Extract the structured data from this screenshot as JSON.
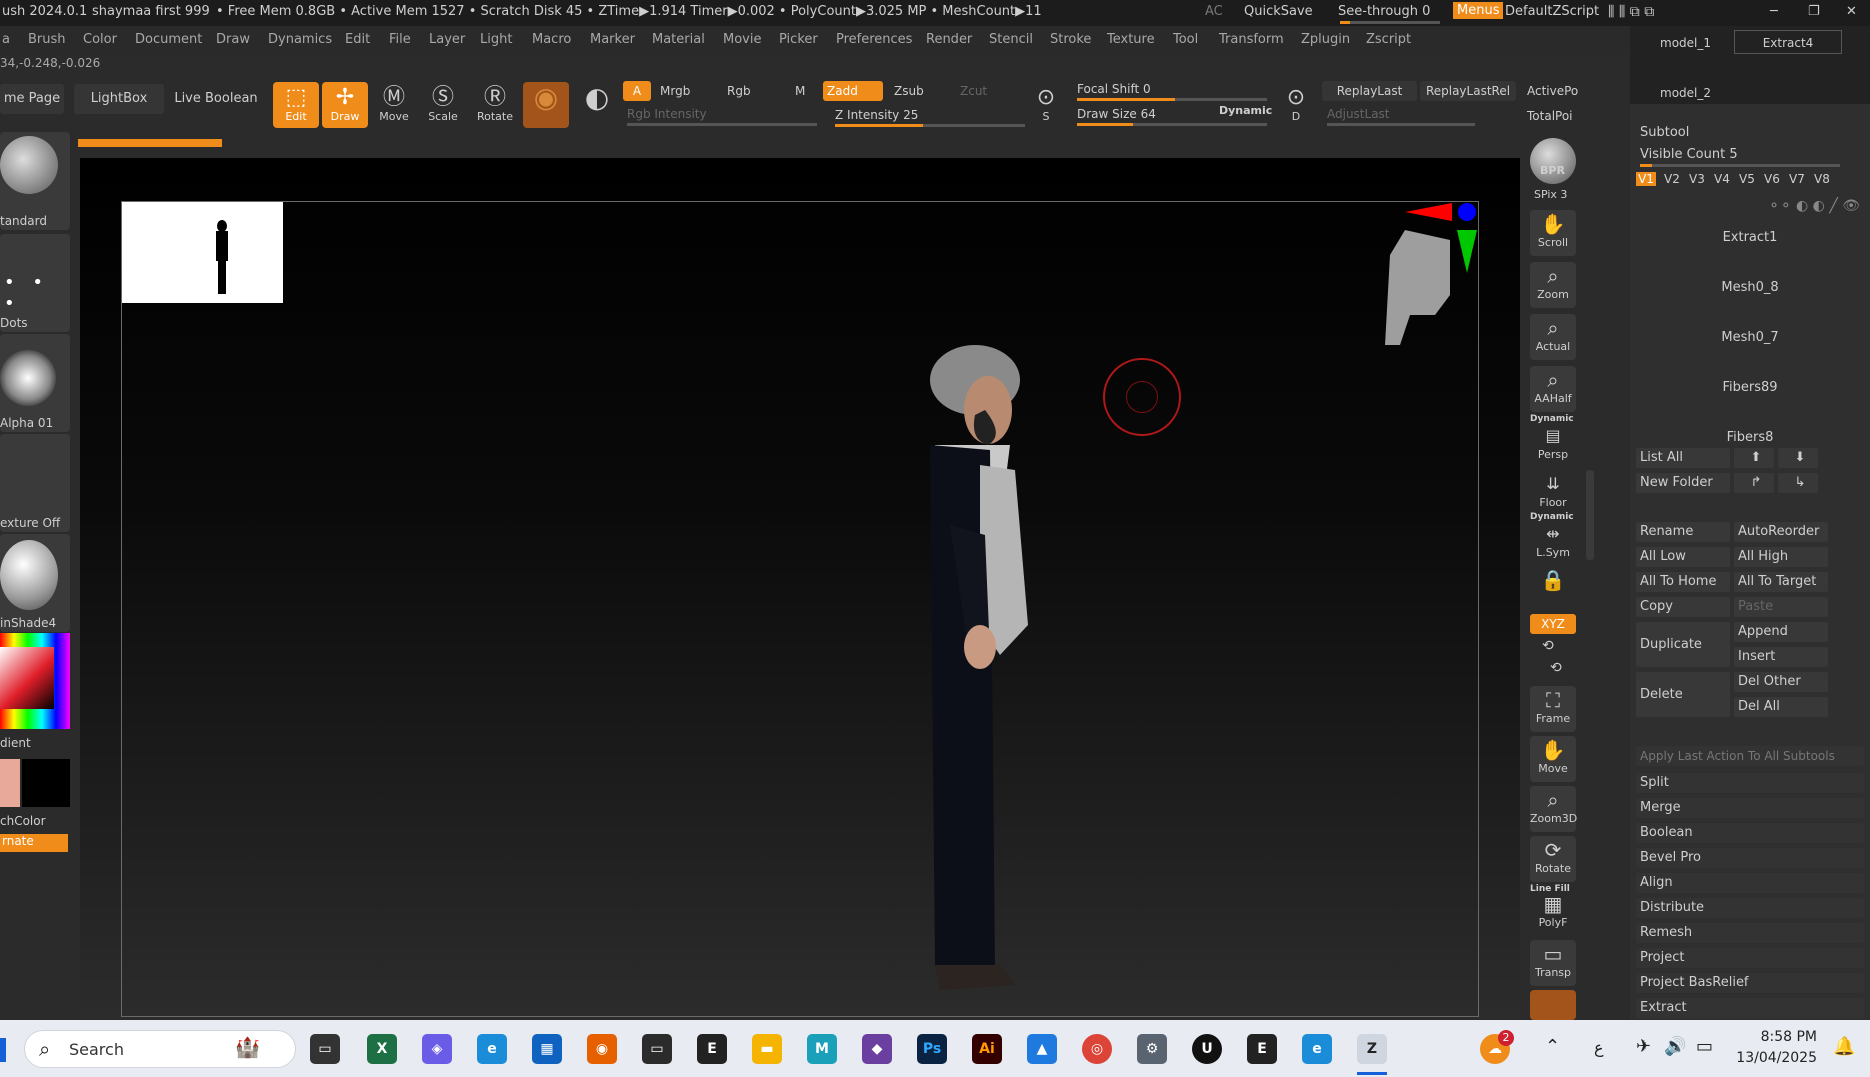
{
  "titlebar": {
    "app": "ush 2024.0.1",
    "user": "shaymaa first 999",
    "stats": "• Free Mem 0.8GB • Active Mem 1527 • Scratch Disk 45 • ZTime▶1.914 Timer▶0.002 • PolyCount▶3.025 MP • MeshCount▶11",
    "ac": "AC",
    "quicksave": "QuickSave",
    "seethrough": "See-through  0",
    "menus": "Menus",
    "script": "DefaultZScript"
  },
  "menubar": [
    "a",
    "Brush",
    "Color",
    "Document",
    "Draw",
    "Dynamics",
    "Edit",
    "File",
    "Layer",
    "Light",
    "Macro",
    "Marker",
    "Material",
    "Movie",
    "Picker",
    "Preferences",
    "Render",
    "Stencil",
    "Stroke",
    "Texture",
    "Tool",
    "Transform",
    "Zplugin",
    "Zscript"
  ],
  "coords": "34,-0.248,-0.026",
  "toolbar": {
    "home": "me Page",
    "lightbox": "LightBox",
    "liveboolean": "Live Boolean",
    "edit": "Edit",
    "draw": "Draw",
    "move": "Move",
    "scale": "Scale",
    "rotate": "Rotate",
    "a": "A",
    "mrgb": "Mrgb",
    "rgb": "Rgb",
    "m": "M",
    "zadd": "Zadd",
    "zsub": "Zsub",
    "zcut": "Zcut",
    "rgb_intensity": "Rgb Intensity",
    "z_intensity": "Z Intensity 25",
    "focal_shift": "Focal Shift 0",
    "draw_size": "Draw Size 64",
    "dynamic": "Dynamic",
    "replaylast": "ReplayLast",
    "replaylastrel": "ReplayLastRel",
    "adjustlast": "AdjustLast",
    "activepo": "ActivePo",
    "totalpoi": "TotalPoi",
    "s_label": "S",
    "d_label": "D"
  },
  "leftshelf": [
    "tandard",
    "Dots",
    "Alpha 01",
    "exture Off",
    "inShade4"
  ],
  "leftshelf_extra": {
    "gradient": "dient",
    "switchcolor": "chColor",
    "alternate": "rnate"
  },
  "rightshelf": [
    "BPR",
    "SPix 3",
    "Scroll",
    "Zoom",
    "Actual",
    "AAHalf",
    "Persp",
    "Floor",
    "L.Sym",
    "",
    "Frame",
    "Move",
    "Zoom3D",
    "Rotate",
    "PolyF",
    "Transp"
  ],
  "rightshelf_extra": {
    "xyz": "XYZ",
    "dynamic1": "Dynamic",
    "dynamic2": "Dynamic",
    "linefill": "Line Fill"
  },
  "subtool": {
    "top_items": [
      "model_1",
      "Extract4",
      "model_2"
    ],
    "header": "Subtool",
    "visible_count": "Visible Count 5",
    "versions": [
      "V1",
      "V2",
      "V3",
      "V4",
      "V5",
      "V6",
      "V7",
      "V8"
    ],
    "items": [
      "Extract1",
      "Mesh0_8",
      "Mesh0_7",
      "Fibers89",
      "Fibers8"
    ],
    "list_all": "List All",
    "new_folder": "New Folder",
    "rename": "Rename",
    "autoreorder": "AutoReorder",
    "all_low": "All Low",
    "all_high": "All High",
    "all_to_home": "All To Home",
    "all_to_target": "All To Target",
    "copy": "Copy",
    "paste": "Paste",
    "duplicate": "Duplicate",
    "append": "Append",
    "insert": "Insert",
    "delete": "Delete",
    "del_other": "Del Other",
    "del_all": "Del All",
    "apply_last": "Apply Last Action To All Subtools",
    "actions": [
      "Split",
      "Merge",
      "Boolean",
      "Bevel Pro",
      "Align",
      "Distribute",
      "Remesh",
      "Project",
      "Project BasRelief",
      "Extract"
    ]
  },
  "taskbar": {
    "search_placeholder": "Search",
    "time": "8:58 PM",
    "date": "13/04/2025",
    "badge": "2",
    "lang": "ع"
  },
  "colors": {
    "accent": "#f08c1a",
    "canvas_top": "#000000",
    "panel": "#2f2f2f"
  }
}
